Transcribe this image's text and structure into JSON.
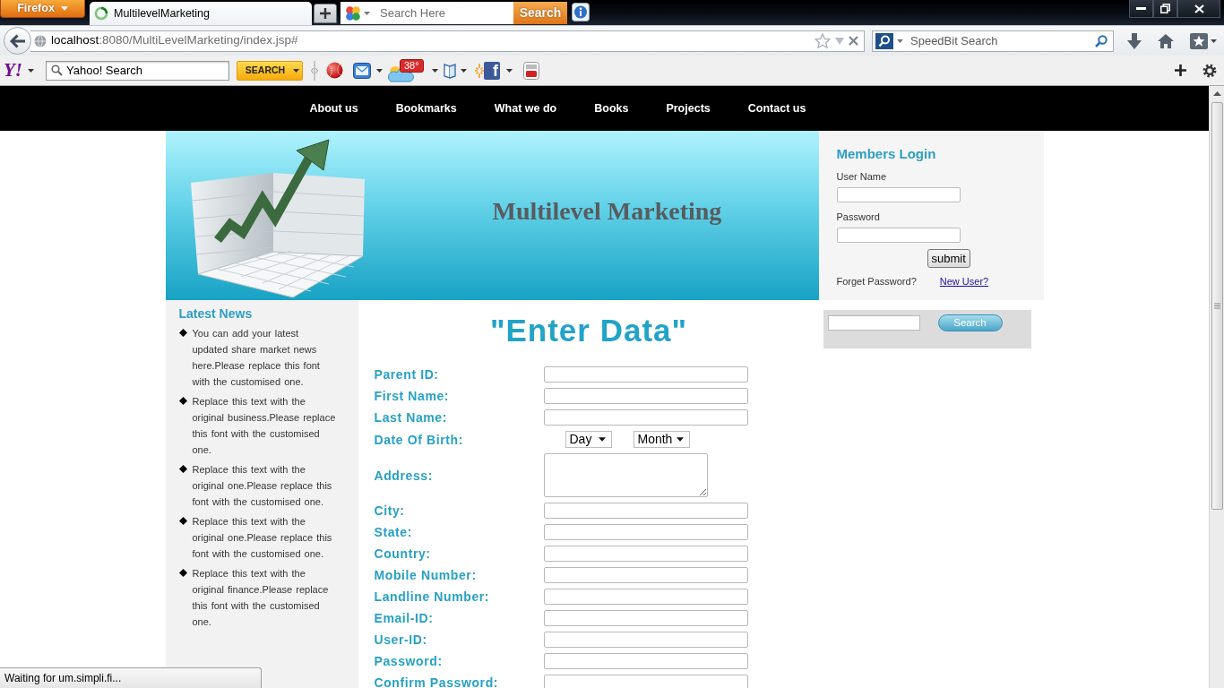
{
  "window": {
    "menu_button": "Firefox",
    "tabs": [
      {
        "title": "MultilevelMarketing",
        "selected": true
      }
    ],
    "search": {
      "placeholder": "Search Here",
      "button": "Search"
    }
  },
  "navigation": {
    "address": {
      "host": "localhost",
      "path": ":8080/MultiLevelMarketing/index.jsp#"
    },
    "search": {
      "placeholder": "SpeedBit Search"
    }
  },
  "toolbar": {
    "logo": "Y!",
    "search": {
      "value": "Yahoo! Search",
      "button": "SEARCH"
    },
    "weather_badge": "38°",
    "social_button": "f"
  },
  "site": {
    "nav": [
      {
        "label": "About us"
      },
      {
        "label": "Bookmarks"
      },
      {
        "label": "What we do"
      },
      {
        "label": "Books"
      },
      {
        "label": "Projects"
      },
      {
        "label": "Contact us"
      }
    ],
    "banner": {
      "title": "Multilevel Marketing"
    },
    "login": {
      "heading": "Members Login",
      "fields": [
        {
          "label": "User Name"
        },
        {
          "label": "Password"
        }
      ],
      "submit": "submit",
      "forgot": "Forget Password?",
      "new_user": "New User?"
    },
    "news": {
      "heading": "Latest News",
      "items": [
        "You can add your latest updated share market news here.Please replace this font with the customised one.",
        "Replace this text with the original business.Please replace this font with the customised one.",
        "Replace this text with the original one.Please replace this font with the customised one.",
        "Replace this text with the original one.Please replace this font with the customised one.",
        "Replace this text with the original finance.Please replace this font with the customised one."
      ]
    },
    "form": {
      "heading": "\"Enter Data\"",
      "fields": [
        {
          "label": "Parent ID:",
          "kind": "text"
        },
        {
          "label": "First Name:",
          "kind": "text"
        },
        {
          "label": "Last Name:",
          "kind": "text"
        },
        {
          "label": "Date Of Birth:",
          "kind": "date",
          "selects": [
            "Day",
            "Month"
          ]
        },
        {
          "label": "Address:",
          "kind": "textarea"
        },
        {
          "label": "City:",
          "kind": "text"
        },
        {
          "label": "State:",
          "kind": "text"
        },
        {
          "label": "Country:",
          "kind": "text"
        },
        {
          "label": "Mobile Number:",
          "kind": "text"
        },
        {
          "label": "Landline Number:",
          "kind": "text"
        },
        {
          "label": "Email-ID:",
          "kind": "text"
        },
        {
          "label": "User-ID:",
          "kind": "text"
        },
        {
          "label": "Password:",
          "kind": "password"
        },
        {
          "label": "Confirm Password:",
          "kind": "password"
        }
      ]
    },
    "side_search": {
      "button": "Search"
    }
  },
  "status_bar": {
    "text": "Waiting for um.simpli.fi..."
  }
}
